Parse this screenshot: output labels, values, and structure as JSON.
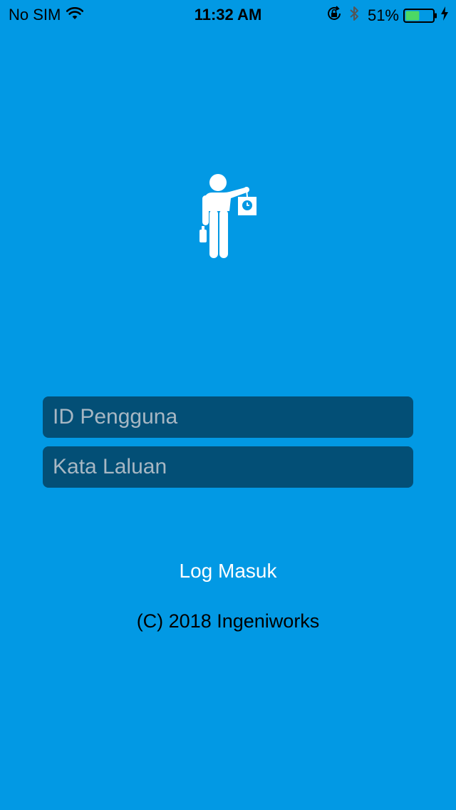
{
  "status_bar": {
    "carrier": "No SIM",
    "time": "11:32 AM",
    "battery_percent": "51%",
    "battery_level": 0.51,
    "battery_color": "#4CD964",
    "icons": [
      "wifi-icon",
      "orientation-lock-icon",
      "bluetooth-icon",
      "battery-icon",
      "charging-icon"
    ]
  },
  "app": {
    "logo_icon": "person-punch-clock-icon",
    "background_color": "#0299E4",
    "field_color": "#034F76"
  },
  "login_form": {
    "user_id_placeholder": "ID Pengguna",
    "user_id_value": "",
    "password_placeholder": "Kata Laluan",
    "password_value": "",
    "login_label": "Log Masuk"
  },
  "footer": {
    "copyright": "(C) 2018 Ingeniworks"
  }
}
